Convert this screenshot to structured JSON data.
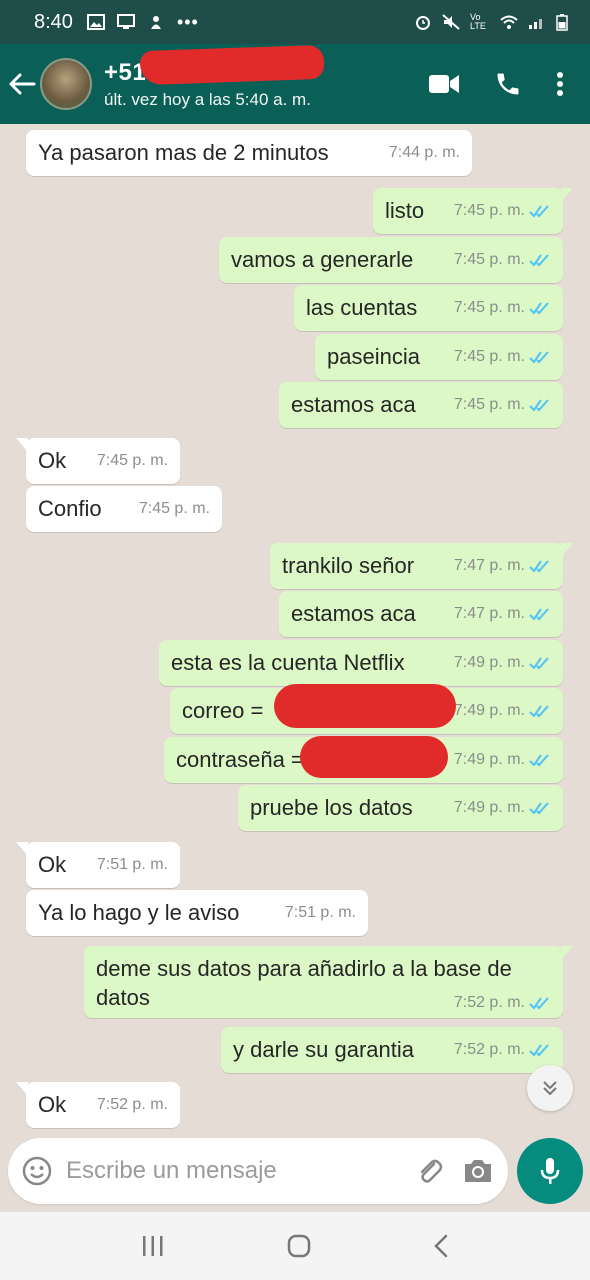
{
  "status_bar": {
    "time": "8:40",
    "left_icons": [
      "image-icon",
      "cast-icon",
      "app-icon",
      "more-icon"
    ],
    "right_icons": [
      "alarm-icon",
      "mute-icon",
      "volte-icon",
      "wifi-icon",
      "signal-icon",
      "battery-icon"
    ],
    "volte_label": "Vo LTE"
  },
  "header": {
    "contact_name": "+51",
    "last_seen": "últ. vez hoy a las 5:40 a. m."
  },
  "messages": [
    {
      "dir": "in",
      "text": "Ya pasaron mas de 2 minutos",
      "time": "7:44 p. m."
    },
    {
      "dir": "out",
      "text": "listo",
      "time": "7:45 p. m."
    },
    {
      "dir": "out",
      "text": "vamos a generarle",
      "time": "7:45 p. m."
    },
    {
      "dir": "out",
      "text": "las cuentas",
      "time": "7:45 p. m."
    },
    {
      "dir": "out",
      "text": "paseincia",
      "time": "7:45 p. m."
    },
    {
      "dir": "out",
      "text": "estamos aca",
      "time": "7:45 p. m."
    },
    {
      "dir": "in",
      "text": "Ok",
      "time": "7:45 p. m."
    },
    {
      "dir": "in",
      "text": "Confio",
      "time": "7:45 p. m."
    },
    {
      "dir": "out",
      "text": "trankilo señor",
      "time": "7:47 p. m."
    },
    {
      "dir": "out",
      "text": "estamos aca",
      "time": "7:47 p. m."
    },
    {
      "dir": "out",
      "text": "esta es la cuenta Netflix",
      "time": "7:49 p. m."
    },
    {
      "dir": "out",
      "text": "correo =",
      "time": "7:49 p. m."
    },
    {
      "dir": "out",
      "text": "contraseña =",
      "time": "7:49 p. m."
    },
    {
      "dir": "out",
      "text": "pruebe los datos",
      "time": "7:49 p. m."
    },
    {
      "dir": "in",
      "text": "Ok",
      "time": "7:51 p. m."
    },
    {
      "dir": "in",
      "text": "Ya lo hago y le aviso",
      "time": "7:51 p. m."
    },
    {
      "dir": "out",
      "text": "deme sus datos para añadirlo a la base de datos",
      "time": "7:52 p. m."
    },
    {
      "dir": "out",
      "text": "y darle su garantia",
      "time": "7:52 p. m."
    },
    {
      "dir": "in",
      "text": "Ok",
      "time": "7:52 p. m."
    }
  ],
  "composer": {
    "placeholder": "Escribe un mensaje"
  },
  "colors": {
    "status_bar": "#1f4e4a",
    "app_bar": "#0a5f56",
    "chat_bg": "#e5ddd5",
    "outgoing_bubble": "#dcf8c6",
    "incoming_bubble": "#ffffff",
    "read_ticks": "#4fc3f7",
    "mic_button": "#058c7e",
    "redaction": "#e12b2b"
  }
}
